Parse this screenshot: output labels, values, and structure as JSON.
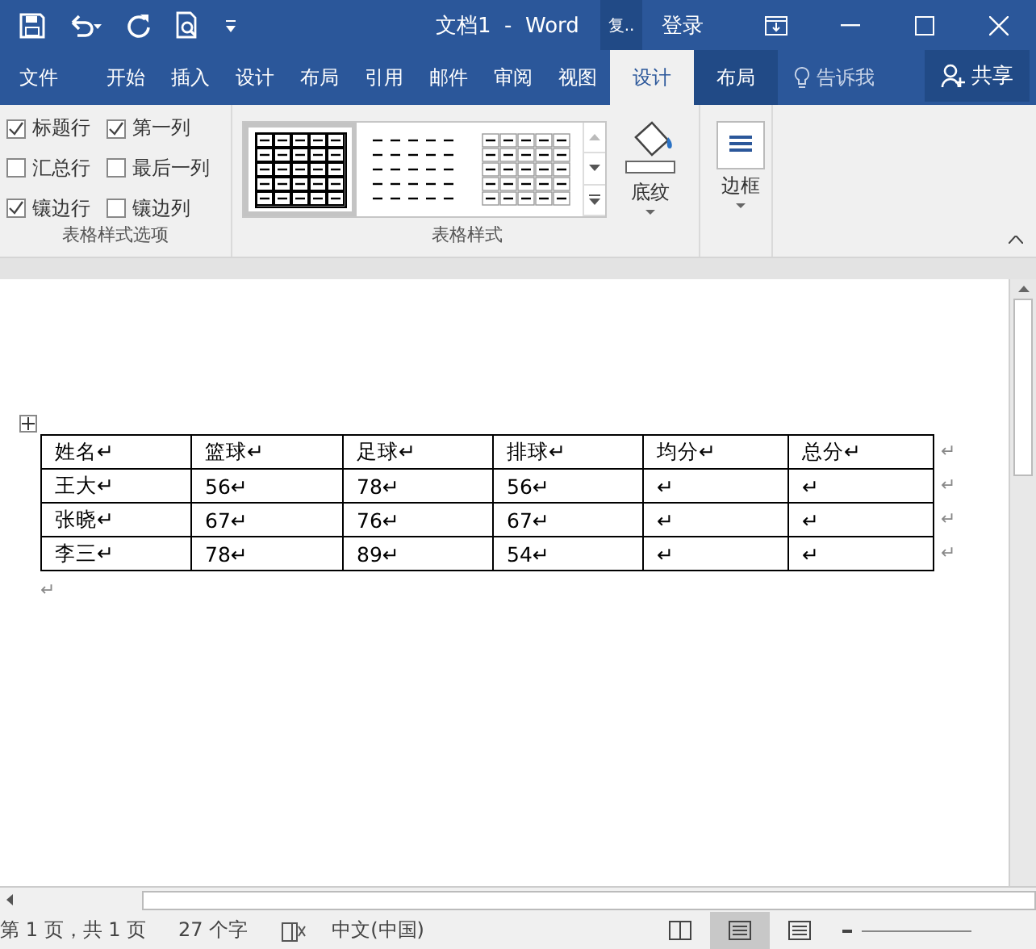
{
  "window": {
    "title": "文档1  -  Word",
    "ribbon_display": "复..",
    "account": "登录"
  },
  "ribbon_tabs": [
    {
      "label": "文件",
      "kind": "normal",
      "selected": false
    },
    {
      "label": "开始",
      "kind": "normal",
      "selected": false
    },
    {
      "label": "插入",
      "kind": "normal",
      "selected": false
    },
    {
      "label": "设计",
      "kind": "normal",
      "selected": false
    },
    {
      "label": "布局",
      "kind": "normal",
      "selected": false
    },
    {
      "label": "引用",
      "kind": "normal",
      "selected": false
    },
    {
      "label": "邮件",
      "kind": "normal",
      "selected": false
    },
    {
      "label": "审阅",
      "kind": "normal",
      "selected": false
    },
    {
      "label": "视图",
      "kind": "normal",
      "selected": false
    },
    {
      "label": "设计",
      "kind": "context",
      "selected": true
    },
    {
      "label": "布局",
      "kind": "context",
      "selected": false
    }
  ],
  "tell_me": "告诉我",
  "share": "共享",
  "style_options": {
    "group_label": "表格样式选项",
    "items": [
      {
        "label": "标题行",
        "checked": true
      },
      {
        "label": "第一列",
        "checked": true
      },
      {
        "label": "汇总行",
        "checked": false
      },
      {
        "label": "最后一列",
        "checked": false
      },
      {
        "label": "镶边行",
        "checked": true
      },
      {
        "label": "镶边列",
        "checked": false
      }
    ]
  },
  "table_styles": {
    "group_label": "表格样式",
    "styles": [
      {
        "kind": "grid",
        "selected": true
      },
      {
        "kind": "plain",
        "selected": false
      },
      {
        "kind": "boxed",
        "selected": false
      }
    ]
  },
  "shading": {
    "label": "底纹"
  },
  "borders": {
    "label": "边框"
  },
  "table": {
    "rows": [
      {
        "cells": [
          "姓名↵",
          "篮球↵",
          "足球↵",
          "排球↵",
          "均分↵",
          "总分↵"
        ],
        "end_mark": "↵"
      },
      {
        "cells": [
          "王大↵",
          "56↵",
          "78↵",
          "56↵",
          "↵",
          "↵"
        ],
        "end_mark": "↵"
      },
      {
        "cells": [
          "张晓↵",
          "67↵",
          "76↵",
          "67↵",
          "↵",
          "↵"
        ],
        "end_mark": "↵"
      },
      {
        "cells": [
          "李三↵",
          "78↵",
          "89↵",
          "54↵",
          "↵",
          "↵"
        ],
        "end_mark": "↵"
      }
    ],
    "after_mark": "↵"
  },
  "status_bar": {
    "page": "第 1 页，共 1 页",
    "words": "27 个字",
    "language": "中文(中国)",
    "views": [
      {
        "selected": false
      },
      {
        "selected": true
      },
      {
        "selected": false
      }
    ]
  }
}
